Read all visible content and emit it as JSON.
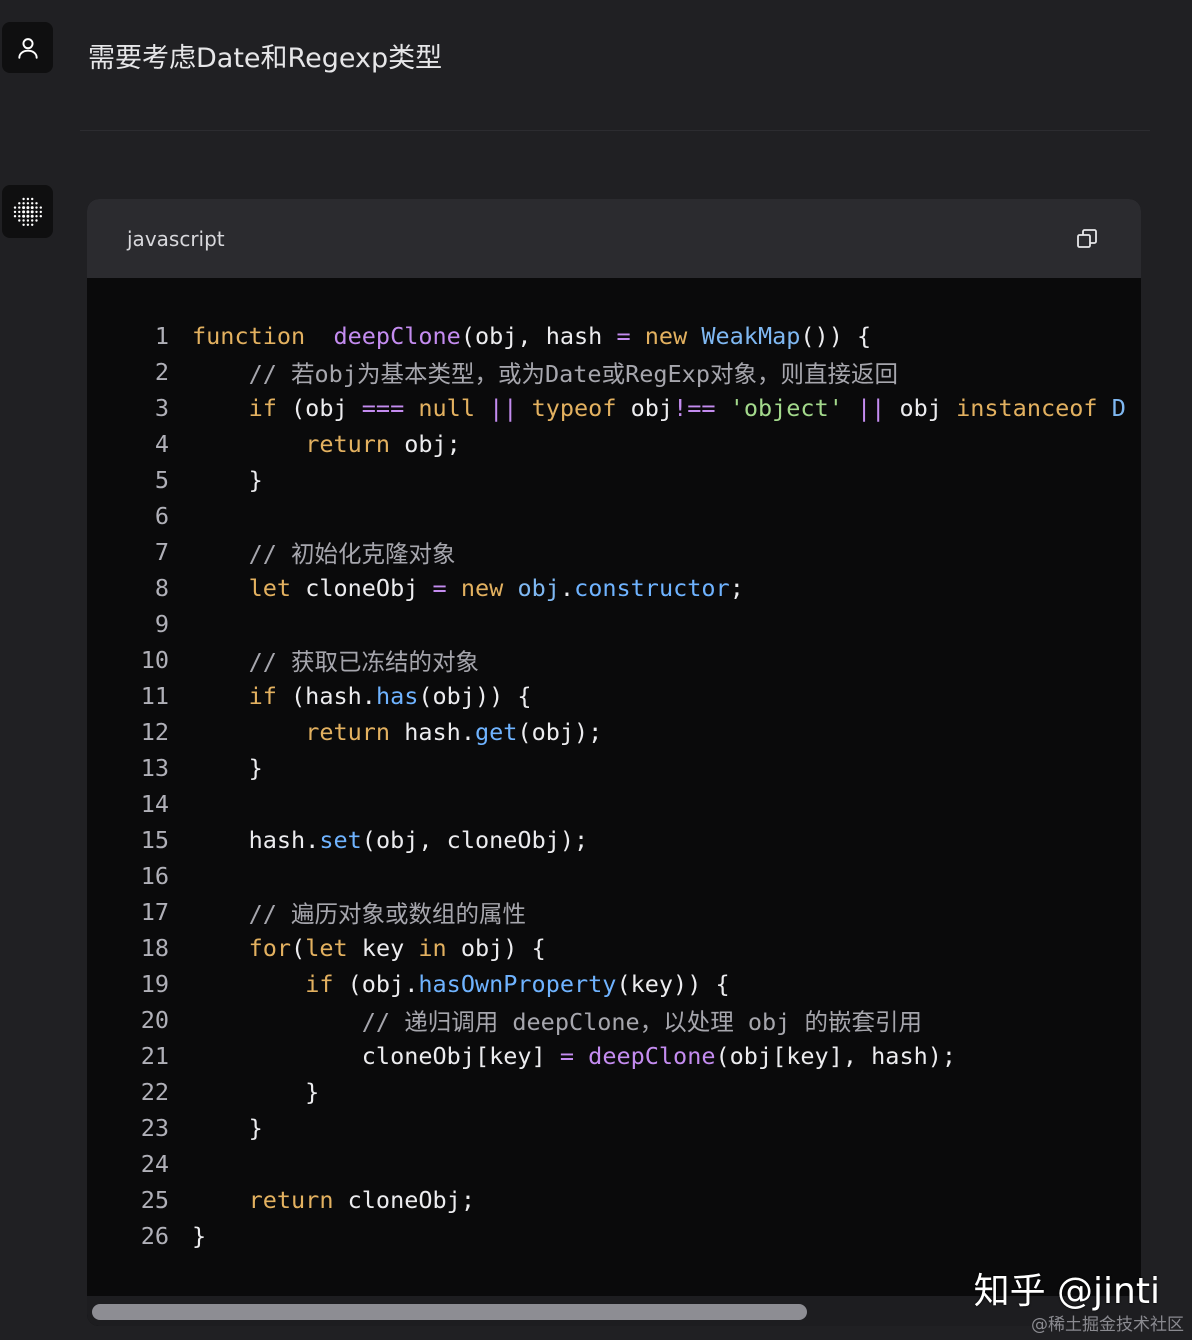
{
  "user_message": {
    "text": "需要考虑Date和Regexp类型",
    "avatar_icon": "user-icon"
  },
  "bot": {
    "avatar_icon": "dot-grid-icon"
  },
  "code_block": {
    "language": "javascript",
    "copy_icon": "copy-icon",
    "lines": [
      {
        "n": "1",
        "tokens": [
          [
            "kw",
            "function"
          ],
          [
            "",
            "  "
          ],
          [
            "fn",
            "deepClone"
          ],
          [
            "",
            "(obj, hash "
          ],
          [
            "op",
            "="
          ],
          [
            "",
            ""
          ],
          [
            "kw",
            " new"
          ],
          [
            "",
            ""
          ],
          [
            "cls",
            " WeakMap"
          ],
          [
            "",
            "()) {"
          ]
        ]
      },
      {
        "n": "2",
        "tokens": [
          [
            "cm",
            "    // 若obj为基本类型，或为Date或RegExp对象，则直接返回"
          ]
        ]
      },
      {
        "n": "3",
        "tokens": [
          [
            "",
            "    "
          ],
          [
            "kw",
            "if"
          ],
          [
            "",
            " (obj "
          ],
          [
            "op",
            "==="
          ],
          [
            "",
            " "
          ],
          [
            "kw",
            "null"
          ],
          [
            "",
            " "
          ],
          [
            "op",
            "||"
          ],
          [
            "",
            " "
          ],
          [
            "kw",
            "typeof"
          ],
          [
            "",
            " obj"
          ],
          [
            "op",
            "!=="
          ],
          [
            "",
            " "
          ],
          [
            "str",
            "'object'"
          ],
          [
            "",
            " "
          ],
          [
            "op",
            "||"
          ],
          [
            "",
            " obj "
          ],
          [
            "kw",
            "instanceof"
          ],
          [
            "",
            " "
          ],
          [
            "cls",
            "D"
          ]
        ]
      },
      {
        "n": "4",
        "tokens": [
          [
            "",
            "        "
          ],
          [
            "kw",
            "return"
          ],
          [
            "",
            " obj;"
          ]
        ]
      },
      {
        "n": "5",
        "tokens": [
          [
            "",
            "    }"
          ]
        ]
      },
      {
        "n": "6",
        "tokens": [
          [
            "",
            ""
          ]
        ]
      },
      {
        "n": "7",
        "tokens": [
          [
            "cm",
            "    // 初始化克隆对象"
          ]
        ]
      },
      {
        "n": "8",
        "tokens": [
          [
            "",
            "    "
          ],
          [
            "kw",
            "let"
          ],
          [
            "",
            " cloneObj "
          ],
          [
            "op",
            "="
          ],
          [
            "",
            " "
          ],
          [
            "kw",
            "new"
          ],
          [
            "",
            " "
          ],
          [
            "cls",
            "obj"
          ],
          [
            "",
            "."
          ],
          [
            "prop",
            "constructor"
          ],
          [
            "",
            ";"
          ]
        ]
      },
      {
        "n": "9",
        "tokens": [
          [
            "",
            ""
          ]
        ]
      },
      {
        "n": "10",
        "tokens": [
          [
            "cm",
            "    // 获取已冻结的对象"
          ]
        ]
      },
      {
        "n": "11",
        "tokens": [
          [
            "",
            "    "
          ],
          [
            "kw",
            "if"
          ],
          [
            "",
            " (hash."
          ],
          [
            "prop",
            "has"
          ],
          [
            "",
            "(obj)) {"
          ]
        ]
      },
      {
        "n": "12",
        "tokens": [
          [
            "",
            "        "
          ],
          [
            "kw",
            "return"
          ],
          [
            "",
            " hash."
          ],
          [
            "prop",
            "get"
          ],
          [
            "",
            "(obj);"
          ]
        ]
      },
      {
        "n": "13",
        "tokens": [
          [
            "",
            "    }"
          ]
        ]
      },
      {
        "n": "14",
        "tokens": [
          [
            "",
            ""
          ]
        ]
      },
      {
        "n": "15",
        "tokens": [
          [
            "",
            "    hash."
          ],
          [
            "prop",
            "set"
          ],
          [
            "",
            "(obj, cloneObj);"
          ]
        ]
      },
      {
        "n": "16",
        "tokens": [
          [
            "",
            ""
          ]
        ]
      },
      {
        "n": "17",
        "tokens": [
          [
            "cm",
            "    // 遍历对象或数组的属性"
          ]
        ]
      },
      {
        "n": "18",
        "tokens": [
          [
            "",
            "    "
          ],
          [
            "kw",
            "for"
          ],
          [
            "",
            "("
          ],
          [
            "kw",
            "let"
          ],
          [
            "",
            " key "
          ],
          [
            "kw",
            "in"
          ],
          [
            "",
            " obj) {"
          ]
        ]
      },
      {
        "n": "19",
        "tokens": [
          [
            "",
            "        "
          ],
          [
            "kw",
            "if"
          ],
          [
            "",
            " (obj."
          ],
          [
            "prop",
            "hasOwnProperty"
          ],
          [
            "",
            "(key)) {"
          ]
        ]
      },
      {
        "n": "20",
        "tokens": [
          [
            "cm",
            "            // 递归调用 deepClone，以处理 obj 的嵌套引用"
          ]
        ]
      },
      {
        "n": "21",
        "tokens": [
          [
            "",
            "            cloneObj[key] "
          ],
          [
            "op",
            "="
          ],
          [
            "",
            " "
          ],
          [
            "fn",
            "deepClone"
          ],
          [
            "",
            "(obj[key], hash);"
          ]
        ]
      },
      {
        "n": "22",
        "tokens": [
          [
            "",
            "        }"
          ]
        ]
      },
      {
        "n": "23",
        "tokens": [
          [
            "",
            "    }"
          ]
        ]
      },
      {
        "n": "24",
        "tokens": [
          [
            "",
            ""
          ]
        ]
      },
      {
        "n": "25",
        "tokens": [
          [
            "",
            "    "
          ],
          [
            "kw",
            "return"
          ],
          [
            "",
            " cloneObj;"
          ]
        ]
      },
      {
        "n": "26",
        "tokens": [
          [
            "",
            "}"
          ]
        ]
      }
    ]
  },
  "watermark": {
    "main": "知乎 @jinti",
    "sub": "@稀土掘金技术社区"
  }
}
